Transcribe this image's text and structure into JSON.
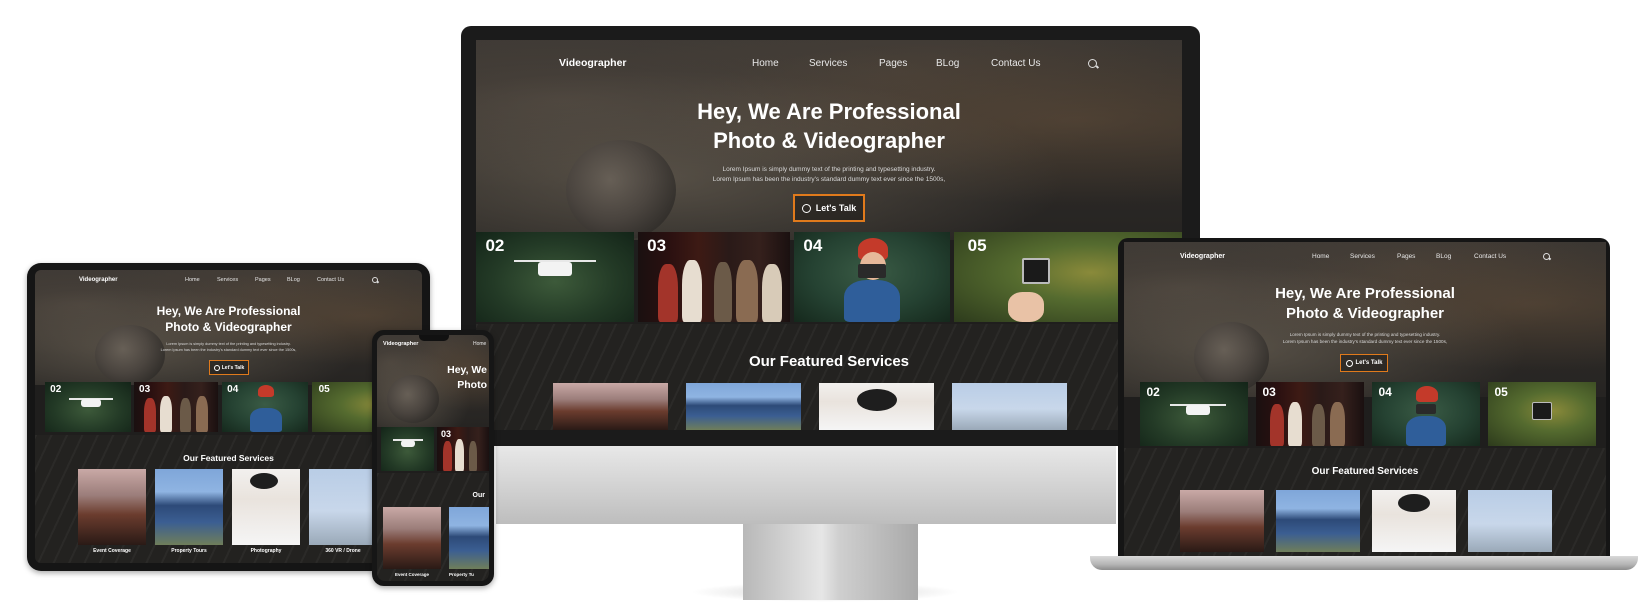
{
  "site": {
    "brand": "Videographer",
    "nav": [
      "Home",
      "Services",
      "Pages",
      "BLog",
      "Contact Us"
    ],
    "hero_title_line1": "Hey, We Are Professional",
    "hero_title_line2": "Photo & Videographer",
    "hero_sub_line1": "Lorem Ipsum is simply dummy text of the printing and typesetting industry.",
    "hero_sub_line2": "Lorem Ipsum has been the industry's standard dummy text ever since the 1500s,",
    "cta_label": "Let's Talk",
    "tiles": [
      "02",
      "03",
      "04",
      "05"
    ],
    "featured_title": "Our Featured Services",
    "services": [
      "Event Coverage",
      "Property Tours",
      "Photography",
      "360 VR / Drone"
    ],
    "phone_featured_title": "Our",
    "phone_hero_line1": "Hey, We",
    "phone_hero_line2": "Photo",
    "phone_service_cap": "Property Tu"
  },
  "colors": {
    "accent": "#e07a1c",
    "screen_bg": "#1f1e1d",
    "page_bg": "#ffffff"
  },
  "icons": {
    "search": "search-icon",
    "cta": "whatsapp-icon"
  }
}
